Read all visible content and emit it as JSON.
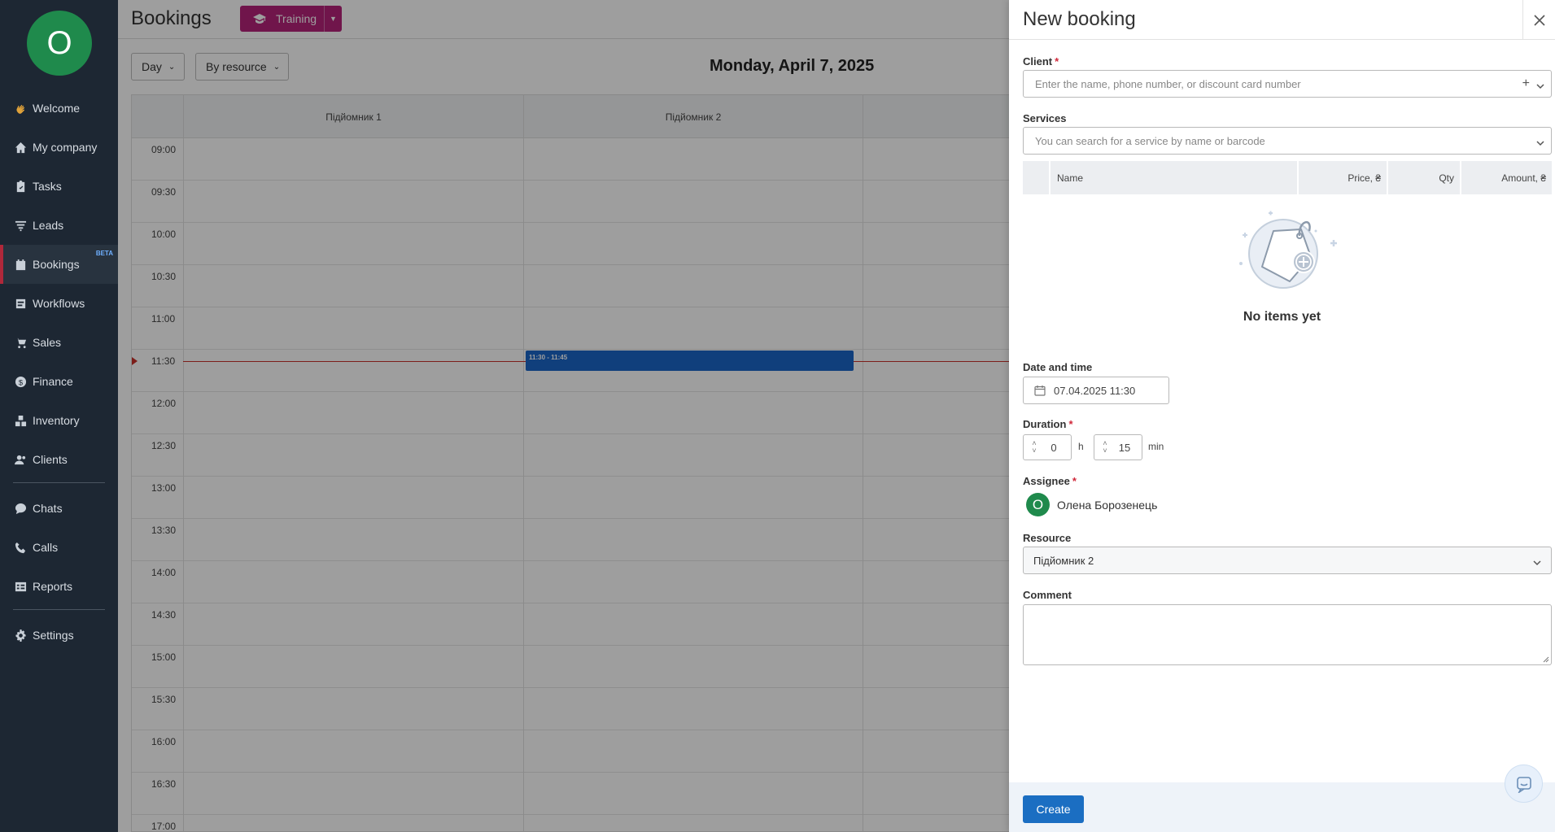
{
  "sidebar": {
    "avatar_letter": "O",
    "items": [
      {
        "label": "Welcome",
        "icon": "waving-hand-icon"
      },
      {
        "label": "My company",
        "icon": "home-icon"
      },
      {
        "label": "Tasks",
        "icon": "clipboard-check-icon"
      },
      {
        "label": "Leads",
        "icon": "funnel-icon"
      },
      {
        "label": "Bookings",
        "icon": "calendar-icon",
        "badge": "BETA",
        "active": true
      },
      {
        "label": "Workflows",
        "icon": "workflow-icon"
      },
      {
        "label": "Sales",
        "icon": "cart-icon"
      },
      {
        "label": "Finance",
        "icon": "coin-icon"
      },
      {
        "label": "Inventory",
        "icon": "boxes-icon"
      },
      {
        "label": "Clients",
        "icon": "users-icon"
      },
      {
        "label": "Chats",
        "icon": "chat-icon"
      },
      {
        "label": "Calls",
        "icon": "phone-icon"
      },
      {
        "label": "Reports",
        "icon": "table-icon"
      },
      {
        "label": "Settings",
        "icon": "gear-icon"
      }
    ]
  },
  "header": {
    "title": "Bookings",
    "training_label": "Training"
  },
  "toolbar": {
    "view_select": "Day",
    "group_select": "By resource",
    "date_heading": "Monday, April 7, 2025"
  },
  "calendar": {
    "resources": [
      "Підйомник 1",
      "Підйомник 2"
    ],
    "times": [
      "09:00",
      "09:30",
      "10:00",
      "10:30",
      "11:00",
      "11:30",
      "12:00",
      "12:30",
      "13:00",
      "13:30",
      "14:00",
      "14:30",
      "15:00",
      "15:30",
      "16:00",
      "16:30",
      "17:00"
    ],
    "event_label": "11:30 - 11:45",
    "now_color": "#c9312b",
    "event_color": "#1a66c9"
  },
  "panel": {
    "title": "New booking",
    "client": {
      "label": "Client",
      "placeholder": "Enter the name, phone number, or discount card number"
    },
    "services": {
      "label": "Services",
      "placeholder": "You can search for a service by name or barcode",
      "columns": [
        "Name",
        "Price, ₴",
        "Qty",
        "Amount, ₴"
      ],
      "empty_text": "No items yet"
    },
    "date_time": {
      "label": "Date and time",
      "value": "07.04.2025 11:30"
    },
    "duration": {
      "label": "Duration",
      "hours": "0",
      "hours_unit": "h",
      "minutes": "15",
      "minutes_unit": "min"
    },
    "assignee": {
      "label": "Assignee",
      "avatar_letter": "O",
      "name": "Олена Борозенець"
    },
    "resource": {
      "label": "Resource",
      "value": "Підйомник 2"
    },
    "comment": {
      "label": "Comment"
    },
    "create_label": "Create"
  },
  "colors": {
    "sidebar_bg": "#1d2733",
    "training": "#b5227a",
    "primary": "#1b6ec2",
    "required": "#d0283a"
  }
}
